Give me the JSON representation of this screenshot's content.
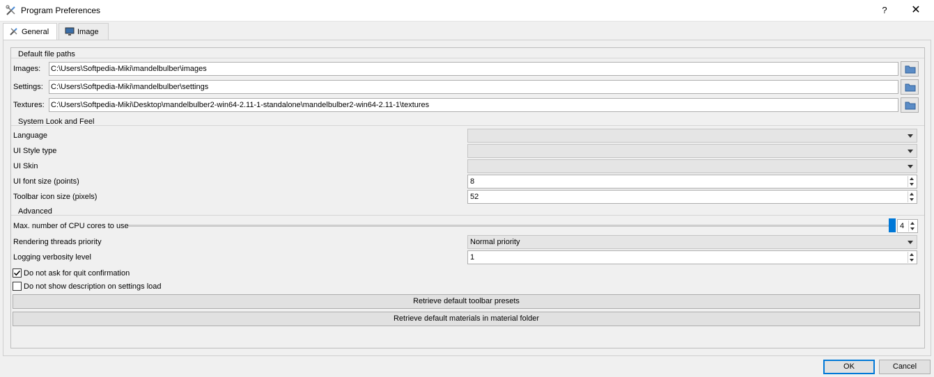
{
  "window": {
    "title": "Program Preferences",
    "help_glyph": "?",
    "close_glyph": "✕"
  },
  "tabs": [
    {
      "label": "General",
      "icon": "tools-icon",
      "active": true
    },
    {
      "label": "Image",
      "icon": "monitor-icon",
      "active": false
    }
  ],
  "paths": {
    "heading": "Default file paths",
    "images_label": "Images:",
    "images_value": "C:\\Users\\Softpedia-Miki\\mandelbulber\\images",
    "settings_label": "Settings:",
    "settings_value": "C:\\Users\\Softpedia-Miki\\mandelbulber\\settings",
    "textures_label": "Textures:",
    "textures_value": "C:\\Users\\Softpedia-Miki\\Desktop\\mandelbulber2-win64-2.11-1-standalone\\mandelbulber2-win64-2.11-1\\textures"
  },
  "look": {
    "heading": "System Look and Feel",
    "language_label": "Language",
    "language_value": "",
    "style_label": "UI Style type",
    "style_value": "",
    "skin_label": "UI Skin",
    "skin_value": "",
    "font_size_label": "UI font size (points)",
    "font_size_value": "8",
    "icon_size_label": "Toolbar icon size (pixels)",
    "icon_size_value": "52"
  },
  "advanced": {
    "heading": "Advanced",
    "cpu_label": "Max. number of CPU cores to use",
    "cpu_value": "4",
    "cpu_slider_fraction": 1.0,
    "priority_label": "Rendering threads priority",
    "priority_value": "Normal priority",
    "logging_label": "Logging verbosity level",
    "logging_value": "1",
    "quit_confirm_label": "Do not ask for quit confirmation",
    "quit_confirm_checked": true,
    "show_desc_label": "Do not show description on settings load",
    "show_desc_checked": false,
    "toolbar_presets_button": "Retrieve default toolbar presets",
    "materials_button": "Retrieve default materials in material folder"
  },
  "footer": {
    "ok_label": "OK",
    "cancel_label": "Cancel"
  },
  "colors": {
    "accent": "#0078d7",
    "window_bg": "#f0f0f0"
  }
}
